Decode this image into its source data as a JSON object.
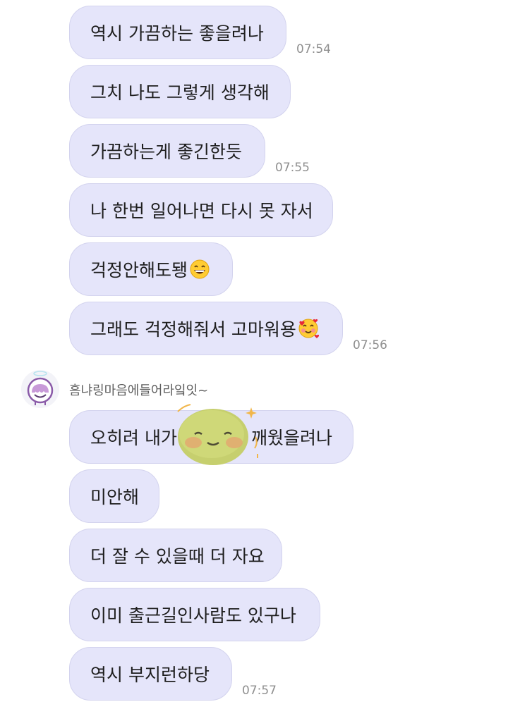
{
  "messages": [
    {
      "text": "역시 가끔하는 좋을려나",
      "time": "07:54"
    },
    {
      "text": "그치 나도 그렇게 생각해",
      "time": ""
    },
    {
      "text": "가끔하는게 좋긴한듯",
      "time": "07:55"
    },
    {
      "text": "나 한번 일어나면 다시 못 자서",
      "time": ""
    },
    {
      "text": "걱정안해도됑",
      "time": "",
      "emoji": "grinning-face-emoji"
    },
    {
      "text": "그래도 걱정해줘서 고마워용",
      "time": "07:56",
      "emoji": "smiling-face-with-hearts-emoji"
    }
  ],
  "sender": {
    "name": "흠냐링마음에들어라잌잇~",
    "avatar_icon": "cartoon-avatar-icon"
  },
  "received": [
    {
      "text_before": "오히려 내가",
      "text_after": "깨웠을려나",
      "sticker_icon": "green-blob-sticker-icon",
      "time": ""
    },
    {
      "text": "미안해",
      "time": ""
    },
    {
      "text": "더 잘 수 있을때 더 자요",
      "time": ""
    },
    {
      "text": "이미 출근길인사람도 있구나",
      "time": ""
    },
    {
      "text": "역시 부지런하당",
      "time": "07:57"
    }
  ]
}
